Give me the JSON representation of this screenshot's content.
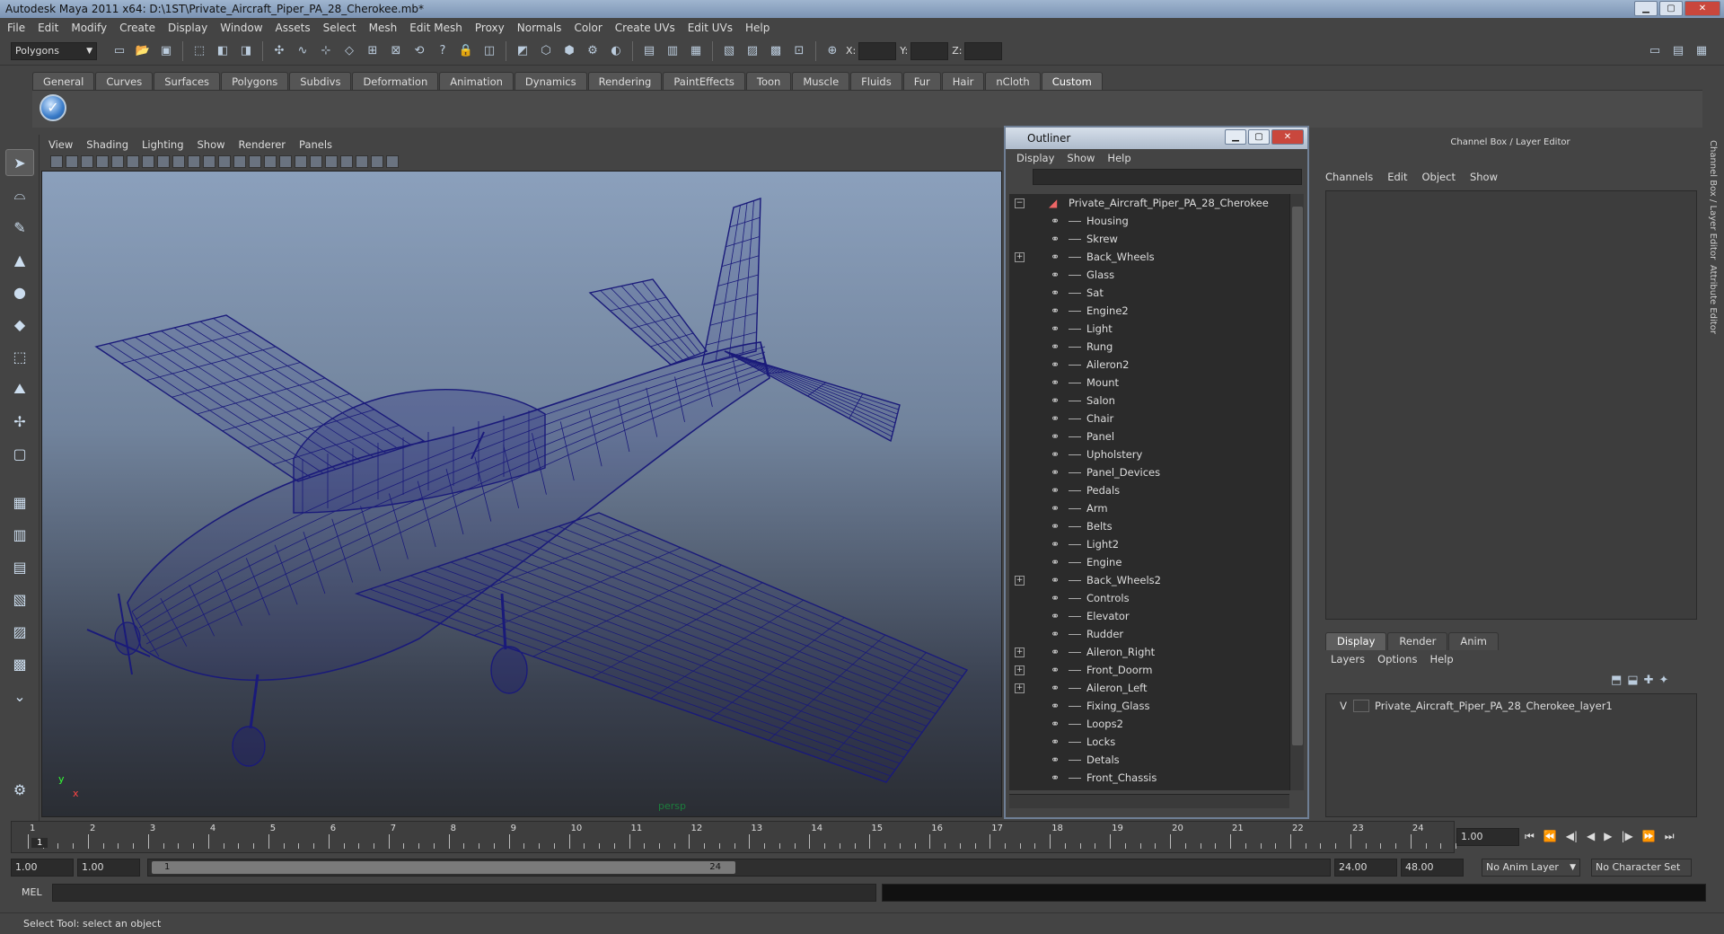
{
  "window": {
    "title": "Autodesk Maya 2011 x64: D:\\1ST\\Private_Aircraft_Piper_PA_28_Cherokee.mb*"
  },
  "menubar": [
    "File",
    "Edit",
    "Modify",
    "Create",
    "Display",
    "Window",
    "Assets",
    "Select",
    "Mesh",
    "Edit Mesh",
    "Proxy",
    "Normals",
    "Color",
    "Create UVs",
    "Edit UVs",
    "Help"
  ],
  "statusline": {
    "mode": "Polygons",
    "x_label": "X:",
    "y_label": "Y:",
    "z_label": "Z:"
  },
  "shelf_tabs": [
    "General",
    "Curves",
    "Surfaces",
    "Polygons",
    "Subdivs",
    "Deformation",
    "Animation",
    "Dynamics",
    "Rendering",
    "PaintEffects",
    "Toon",
    "Muscle",
    "Fluids",
    "Fur",
    "Hair",
    "nCloth",
    "Custom"
  ],
  "shelf_active": "Custom",
  "viewport": {
    "menu": [
      "View",
      "Shading",
      "Lighting",
      "Show",
      "Renderer",
      "Panels"
    ],
    "camera_label": "persp",
    "axis_y": "y",
    "axis_x": "x",
    "wire_color": "#1a1a7a"
  },
  "outliner": {
    "title": "Outliner",
    "menu": [
      "Display",
      "Show",
      "Help"
    ],
    "root": "Private_Aircraft_Piper_PA_28_Cherokee",
    "items": [
      {
        "label": "Housing",
        "expandable": false
      },
      {
        "label": "Skrew",
        "expandable": false
      },
      {
        "label": "Back_Wheels",
        "expandable": true
      },
      {
        "label": "Glass",
        "expandable": false
      },
      {
        "label": "Sat",
        "expandable": false
      },
      {
        "label": "Engine2",
        "expandable": false
      },
      {
        "label": "Light",
        "expandable": false
      },
      {
        "label": "Rung",
        "expandable": false
      },
      {
        "label": "Aileron2",
        "expandable": false
      },
      {
        "label": "Mount",
        "expandable": false
      },
      {
        "label": "Salon",
        "expandable": false
      },
      {
        "label": "Chair",
        "expandable": false
      },
      {
        "label": "Panel",
        "expandable": false
      },
      {
        "label": "Upholstery",
        "expandable": false
      },
      {
        "label": "Panel_Devices",
        "expandable": false
      },
      {
        "label": "Pedals",
        "expandable": false
      },
      {
        "label": "Arm",
        "expandable": false
      },
      {
        "label": "Belts",
        "expandable": false
      },
      {
        "label": "Light2",
        "expandable": false
      },
      {
        "label": "Engine",
        "expandable": false
      },
      {
        "label": "Back_Wheels2",
        "expandable": true
      },
      {
        "label": "Controls",
        "expandable": false
      },
      {
        "label": "Elevator",
        "expandable": false
      },
      {
        "label": "Rudder",
        "expandable": false
      },
      {
        "label": "Aileron_Right",
        "expandable": true
      },
      {
        "label": "Front_Doorm",
        "expandable": true
      },
      {
        "label": "Aileron_Left",
        "expandable": true
      },
      {
        "label": "Fixing_Glass",
        "expandable": false
      },
      {
        "label": "Loops2",
        "expandable": false
      },
      {
        "label": "Locks",
        "expandable": false
      },
      {
        "label": "Detals",
        "expandable": false
      },
      {
        "label": "Front_Chassis",
        "expandable": false
      }
    ]
  },
  "channelbox": {
    "header": "Channel Box / Layer Editor",
    "menu": [
      "Channels",
      "Edit",
      "Object",
      "Show"
    ]
  },
  "layer_editor": {
    "tabs": [
      "Display",
      "Render",
      "Anim"
    ],
    "active_tab": "Display",
    "menu": [
      "Layers",
      "Options",
      "Help"
    ],
    "layer": {
      "visible": "V",
      "name": "Private_Aircraft_Piper_PA_28_Cherokee_layer1"
    }
  },
  "side_tabs": [
    "Channel Box / Layer Editor",
    "Attribute Editor"
  ],
  "timeline": {
    "ticks": [
      "1",
      "2",
      "3",
      "4",
      "5",
      "6",
      "7",
      "8",
      "9",
      "10",
      "11",
      "12",
      "13",
      "14",
      "15",
      "16",
      "17",
      "18",
      "19",
      "20",
      "21",
      "22",
      "23",
      "24"
    ],
    "current_marker": "1",
    "current_frame": "1.00"
  },
  "range": {
    "start": "1.00",
    "playback_start": "1.00",
    "thumb_start": "1",
    "thumb_end": "24",
    "playback_end": "24.00",
    "end": "48.00",
    "anim_layer": "No Anim Layer",
    "character_set": "No Character Set"
  },
  "mel": {
    "label": "MEL"
  },
  "help": {
    "text": "Select Tool: select an object"
  }
}
